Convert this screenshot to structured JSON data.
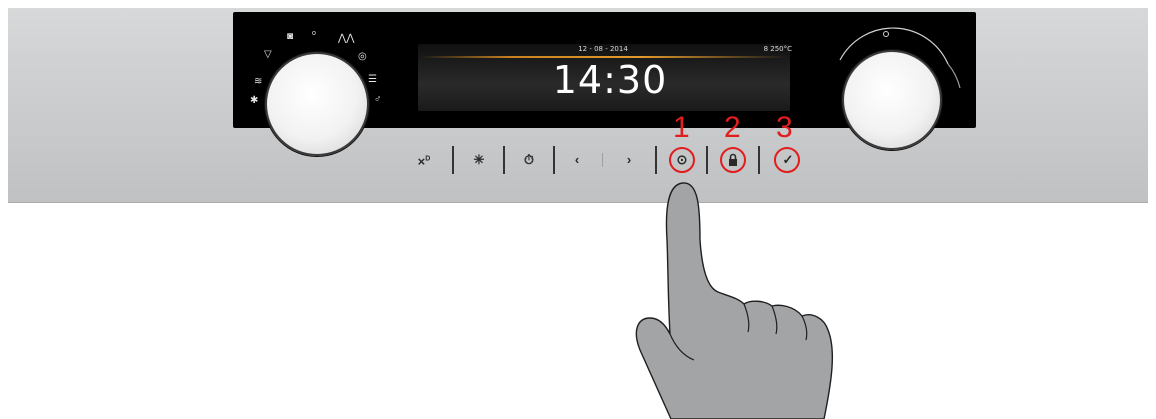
{
  "display": {
    "date": "12 - 08 - 2014",
    "temperature": "8 250°C",
    "time": "14:30"
  },
  "controls": {
    "buttons": [
      {
        "name": "child-lock-button",
        "glyph": "×⁰"
      },
      {
        "name": "light-button",
        "glyph": "☀"
      },
      {
        "name": "alarm-button",
        "glyph": "⏰"
      },
      {
        "name": "prev-button",
        "glyph": "‹"
      },
      {
        "name": "next-button",
        "glyph": "›"
      },
      {
        "name": "settings-button",
        "glyph": "⊙"
      },
      {
        "name": "lock-button",
        "glyph": "🔒"
      },
      {
        "name": "confirm-button",
        "glyph": "✓"
      }
    ]
  },
  "callouts": {
    "one": "1",
    "two": "2",
    "three": "3"
  },
  "colors": {
    "callout": "#e11d1d",
    "accent_line": "#e39a2c",
    "panel": "#000000",
    "steel": "#c8cacc"
  },
  "icons": [
    "defrost-icon",
    "top-heat-icon",
    "fan-icon",
    "grill-icon",
    "bottom-heat-icon",
    "pizza-icon",
    "lamp-icon",
    "eco-icon",
    "steam-icon"
  ]
}
